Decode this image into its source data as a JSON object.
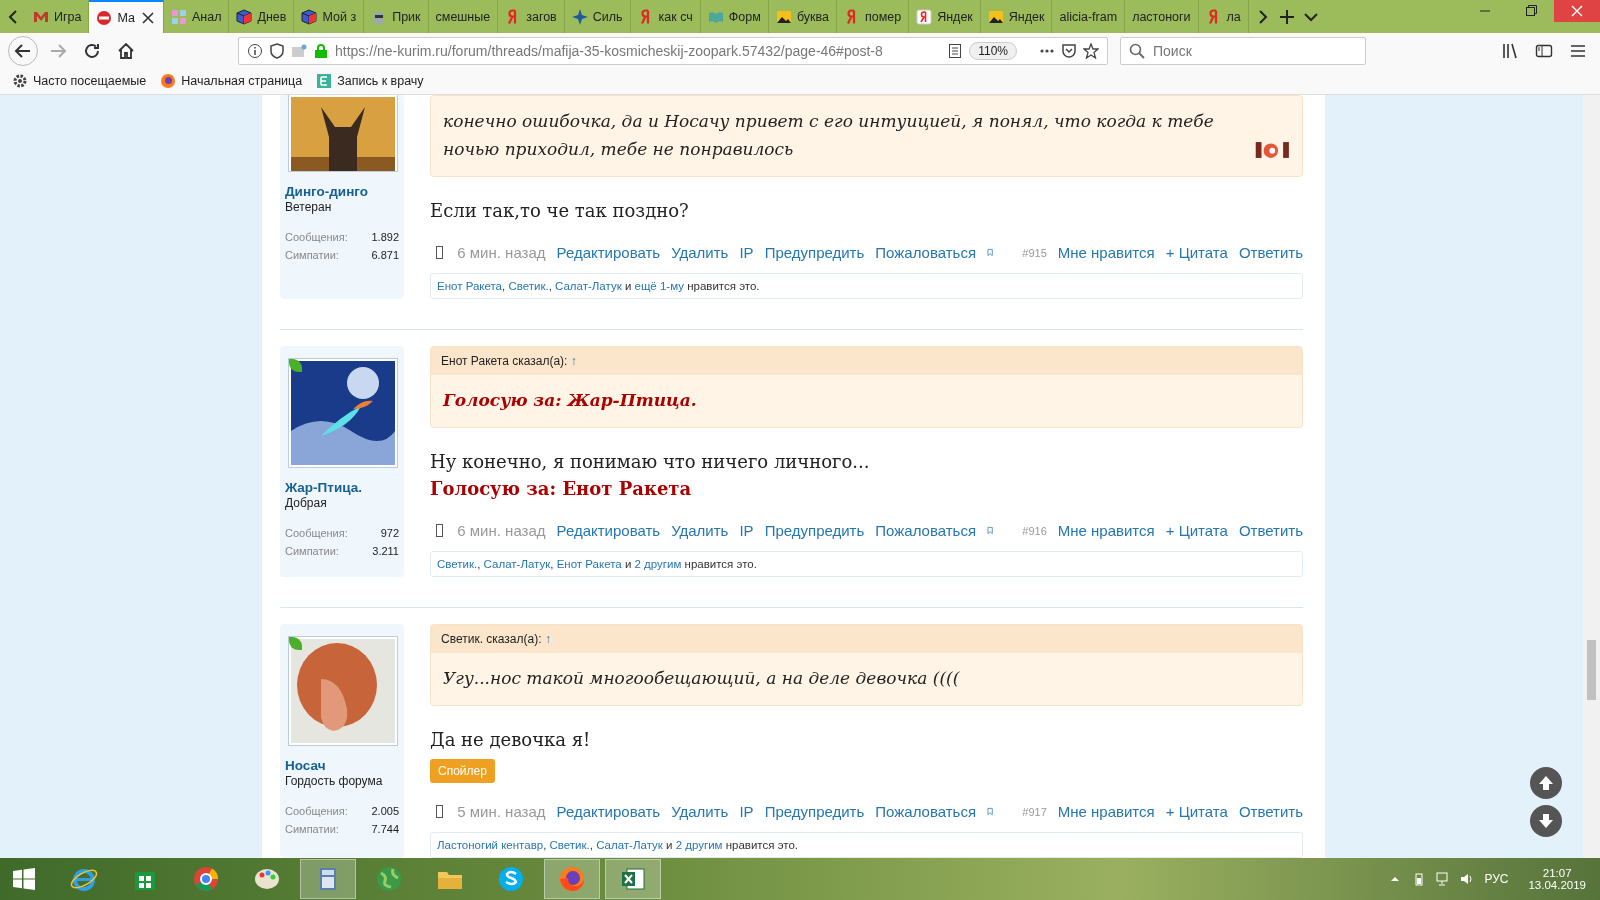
{
  "browser": {
    "tabs": [
      {
        "title": "Игра",
        "selected": false
      },
      {
        "title": "Ма",
        "selected": true
      },
      {
        "title": "Анал",
        "selected": false
      },
      {
        "title": "Днев",
        "selected": false
      },
      {
        "title": "Мой з",
        "selected": false
      },
      {
        "title": "Прик",
        "selected": false
      },
      {
        "title": "смешные",
        "selected": false
      },
      {
        "title": "загов",
        "selected": false
      },
      {
        "title": "Силь",
        "selected": false
      },
      {
        "title": "как сч",
        "selected": false
      },
      {
        "title": "Форм",
        "selected": false
      },
      {
        "title": "буква",
        "selected": false
      },
      {
        "title": "помер",
        "selected": false
      },
      {
        "title": "Яндек",
        "selected": false
      },
      {
        "title": "Яндек",
        "selected": false
      },
      {
        "title": "alicia-fram",
        "selected": false
      },
      {
        "title": "ластоноги",
        "selected": false
      },
      {
        "title": "ла",
        "selected": false
      }
    ],
    "url": "https://ne-kurim.ru/forum/threads/mafija-35-kosmicheskij-zoopark.57432/page-46#post-8",
    "zoom": "110%",
    "search": {
      "placeholder": "Поиск"
    },
    "bookmarks": [
      "Часто посещаемые",
      "Начальная страница",
      "Запись к врачу"
    ]
  },
  "posts": [
    {
      "author": "Динго-динго",
      "rank": "Ветеран",
      "online": false,
      "stats": [
        {
          "label": "Сообщения:",
          "value": "1.892"
        },
        {
          "label": "Симпатии:",
          "value": "6.871"
        }
      ],
      "quote": {
        "kind": "text",
        "text": "конечно ошибочка, да и Носачу привет с его интуицией, я понял, что когда к тебе ночью приходил, тебе не понравилось",
        "sticker": true
      },
      "body": [
        {
          "kind": "text",
          "text": "Если так,то че так поздно?"
        }
      ],
      "selected": false,
      "time": "6 мин. назад",
      "actions": [
        "Редактировать",
        "Удалить",
        "IP",
        "Предупредить",
        "Пожаловаться"
      ],
      "number": "#915",
      "reactions": [
        "Мне нравится",
        "+ Цитата",
        "Ответить"
      ],
      "likes": [
        {
          "kind": "link",
          "text": "Енот Ракета"
        },
        {
          "kind": "plain",
          "text": ", "
        },
        {
          "kind": "link",
          "text": "Светик."
        },
        {
          "kind": "plain",
          "text": ", "
        },
        {
          "kind": "link",
          "text": "Салат-Латук"
        },
        {
          "kind": "plain",
          "text": " и "
        },
        {
          "kind": "link",
          "text": "ещё 1-му"
        },
        {
          "kind": "plain",
          "text": " нравится это."
        }
      ]
    },
    {
      "author": "Жар-Птица.",
      "rank": "Добрая",
      "online": true,
      "stats": [
        {
          "label": "Сообщения:",
          "value": "972"
        },
        {
          "label": "Симпатии:",
          "value": "3.211"
        }
      ],
      "quote": {
        "header": "Енот Ракета сказал(а):",
        "arrow": "↑",
        "kind": "vote",
        "text": "Голосую за: Жар-Птица."
      },
      "body": [
        {
          "kind": "text",
          "text": "Ну конечно, я понимаю что ничего личного..."
        },
        {
          "kind": "vote",
          "text": "Голосую за: Енот Ракета"
        }
      ],
      "selected": false,
      "time": "6 мин. назад",
      "actions": [
        "Редактировать",
        "Удалить",
        "IP",
        "Предупредить",
        "Пожаловаться"
      ],
      "number": "#916",
      "reactions": [
        "Мне нравится",
        "+ Цитата",
        "Ответить"
      ],
      "likes": [
        {
          "kind": "link",
          "text": "Светик."
        },
        {
          "kind": "plain",
          "text": ", "
        },
        {
          "kind": "link",
          "text": "Салат-Латук"
        },
        {
          "kind": "plain",
          "text": ", "
        },
        {
          "kind": "link",
          "text": "Енот Ракета"
        },
        {
          "kind": "plain",
          "text": " и "
        },
        {
          "kind": "link",
          "text": "2 другим"
        },
        {
          "kind": "plain",
          "text": " нравится это."
        }
      ]
    },
    {
      "author": "Носач",
      "rank": "Гордость форума",
      "online": true,
      "stats": [
        {
          "label": "Сообщения:",
          "value": "2.005"
        },
        {
          "label": "Симпатии:",
          "value": "7.744"
        }
      ],
      "quote": {
        "header": "Светик. сказал(а):",
        "arrow": "↑",
        "kind": "text",
        "text": "Угу...нос такой многообещающий, а на деле девочка (((("
      },
      "body": [
        {
          "kind": "text",
          "text": "Да не девочка я!"
        },
        {
          "kind": "spoiler",
          "text": "Спойлер"
        }
      ],
      "selected": false,
      "time": "5 мин. назад",
      "actions": [
        "Редактировать",
        "Удалить",
        "IP",
        "Предупредить",
        "Пожаловаться"
      ],
      "number": "#917",
      "reactions": [
        "Мне нравится",
        "+ Цитата",
        "Ответить"
      ],
      "likes": [
        {
          "kind": "link",
          "text": "Ластоногий кентавр"
        },
        {
          "kind": "plain",
          "text": ", "
        },
        {
          "kind": "link",
          "text": "Светик."
        },
        {
          "kind": "plain",
          "text": ", "
        },
        {
          "kind": "link",
          "text": "Салат-Латук"
        },
        {
          "kind": "plain",
          "text": " и "
        },
        {
          "kind": "link",
          "text": "2 другим"
        },
        {
          "kind": "plain",
          "text": " нравится это."
        }
      ]
    }
  ],
  "taskbar": {
    "apps": [
      {
        "active": false
      },
      {
        "active": false
      },
      {
        "active": false
      },
      {
        "active": false
      },
      {
        "active": true
      },
      {
        "active": false
      },
      {
        "active": false
      },
      {
        "active": false
      },
      {
        "active": true
      },
      {
        "active": true
      }
    ],
    "language": "РУС",
    "time": "21:07",
    "date": "13.04.2019"
  }
}
